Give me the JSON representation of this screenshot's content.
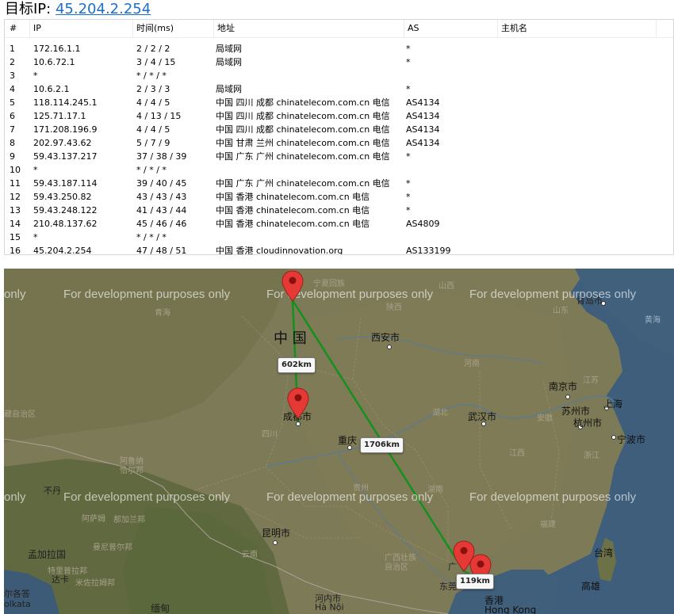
{
  "header": {
    "label": "目标IP:",
    "ip": "45.204.2.254"
  },
  "table": {
    "columns": [
      "#",
      "IP",
      "时间(ms)",
      "地址",
      "AS",
      "主机名"
    ],
    "rows": [
      [
        "1",
        "172.16.1.1",
        "2 / 2 / 2",
        "局域网",
        "*",
        ""
      ],
      [
        "2",
        "10.6.72.1",
        "3 / 4 / 15",
        "局域网",
        "*",
        ""
      ],
      [
        "3",
        "*",
        "* / * / *",
        "",
        "",
        ""
      ],
      [
        "4",
        "10.6.2.1",
        "2 / 3 / 3",
        "局域网",
        "*",
        ""
      ],
      [
        "5",
        "118.114.245.1",
        "4 / 4 / 5",
        "中国 四川 成都 chinatelecom.com.cn 电信",
        "AS4134",
        ""
      ],
      [
        "6",
        "125.71.17.1",
        "4 / 13 / 15",
        "中国 四川 成都 chinatelecom.com.cn 电信",
        "AS4134",
        ""
      ],
      [
        "7",
        "171.208.196.9",
        "4 / 4 / 5",
        "中国 四川 成都 chinatelecom.com.cn 电信",
        "AS4134",
        ""
      ],
      [
        "8",
        "202.97.43.62",
        "5 / 7 / 9",
        "中国 甘肃 兰州 chinatelecom.com.cn 电信",
        "AS4134",
        ""
      ],
      [
        "9",
        "59.43.137.217",
        "37 / 38 / 39",
        "中国 广东 广州 chinatelecom.com.cn 电信",
        "*",
        ""
      ],
      [
        "10",
        "*",
        "* / * / *",
        "",
        "",
        ""
      ],
      [
        "11",
        "59.43.187.114",
        "39 / 40 / 45",
        "中国 广东 广州 chinatelecom.com.cn 电信",
        "*",
        ""
      ],
      [
        "12",
        "59.43.250.82",
        "43 / 43 / 43",
        "中国 香港 chinatelecom.com.cn 电信",
        "*",
        ""
      ],
      [
        "13",
        "59.43.248.122",
        "41 / 43 / 44",
        "中国 香港 chinatelecom.com.cn 电信",
        "*",
        ""
      ],
      [
        "14",
        "210.48.137.62",
        "45 / 46 / 46",
        "中国 香港 chinatelecom.com.cn 电信",
        "AS4809",
        ""
      ],
      [
        "15",
        "*",
        "* / * / *",
        "",
        "",
        ""
      ],
      [
        "16",
        "45.204.2.254",
        "47 / 48 / 51",
        "中国 香港 cloudinnovation.org",
        "AS133199",
        ""
      ]
    ]
  },
  "map": {
    "watermark": "For development purposes only",
    "watermark_partial": "only",
    "distances": [
      "602km",
      "1706km",
      "119km"
    ],
    "labels": {
      "china": "中 国",
      "chengdu": "成都市",
      "xian": "西安市",
      "chongqing": "重庆",
      "nanjing": "南京市",
      "wuhan": "武汉市",
      "shanghai": "上海",
      "suzhou": "苏州市",
      "hangzhou": "杭州市",
      "ningbo": "宁波市",
      "kunming": "昆明市",
      "hongkong": "香港",
      "hongkong_en": "Hong Kong",
      "taiwan": "台湾",
      "kaohsiung": "高雄",
      "qinghai": "青海",
      "sichuan": "四川",
      "shaanxi": "陕西",
      "shanxi": "山西",
      "henan": "河南",
      "hubei": "湖北",
      "hunan": "湖南",
      "guizhou": "贵州",
      "guangxi": "广西壮族\n自治区",
      "jiangxi": "江西",
      "anhui": "安徽",
      "zhejiang": "浙江",
      "jiangsu": "江苏",
      "fujian": "福建",
      "shandong": "山东",
      "yunnan": "云南",
      "ningxia": "宁夏回族",
      "qingdao": "青岛市",
      "yellow_sea": "黄海",
      "bhutan": "不丹",
      "bangladesh": "孟加拉国",
      "dhaka": "达卡",
      "assam": "阿萨姆",
      "arunachal": "阿鲁纳\n恰尔邦",
      "nagaland": "那加兰邦",
      "manipur": "曼尼普尔邦",
      "mizoram": "米佐拉姆邦",
      "meghalaya": "梅加拉亚邦",
      "tripura": "特里普拉邦",
      "kolkata_cn": "尔各答",
      "kolkata": "olkata",
      "myanmar": "缅甸",
      "hanoi_cn": "河内市",
      "hanoi": "Hà Nội",
      "tibet": "藏自治区",
      "guangzhou_partial": "广",
      "dongguan": "东莞"
    }
  }
}
